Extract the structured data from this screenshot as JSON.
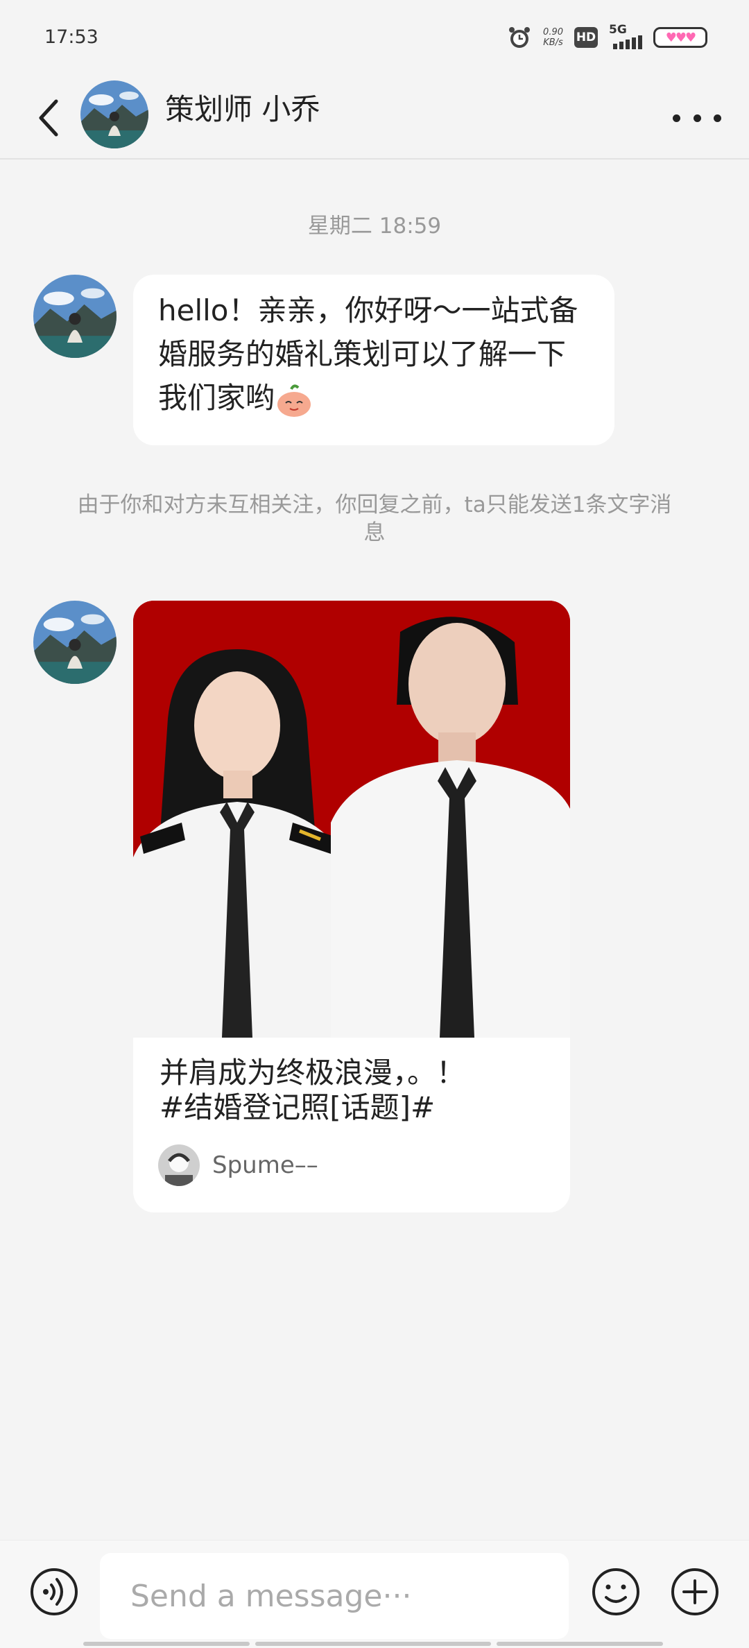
{
  "status_bar": {
    "time": "17:53",
    "net_speed_value": "0.90",
    "net_speed_unit": "KB/s",
    "hd_label": "HD",
    "network_label": "5G"
  },
  "header": {
    "title": "策划师 小乔"
  },
  "chat": {
    "timestamp": "星期二 18:59",
    "message_text": "hello！亲亲，你好呀～一站式备婚服务的婚礼策划可以了解一下我们家哟",
    "notice": "由于你和对方未互相关注，你回复之前，ta只能发送1条文字消息",
    "shared_card": {
      "title_line1": "并肩成为终极浪漫，。！",
      "title_line2": "#结婚登记照[话题]#",
      "author": "Spume––"
    }
  },
  "input_bar": {
    "placeholder": "Send a message···"
  },
  "colors": {
    "background": "#f4f4f4",
    "bubble": "#ffffff",
    "card_image_bg": "#b00000",
    "muted_text": "#999999"
  },
  "icons": {
    "back": "chevron-left-icon",
    "more": "more-dots-icon",
    "voice": "voice-icon",
    "emoji": "emoji-icon",
    "add": "plus-icon"
  }
}
